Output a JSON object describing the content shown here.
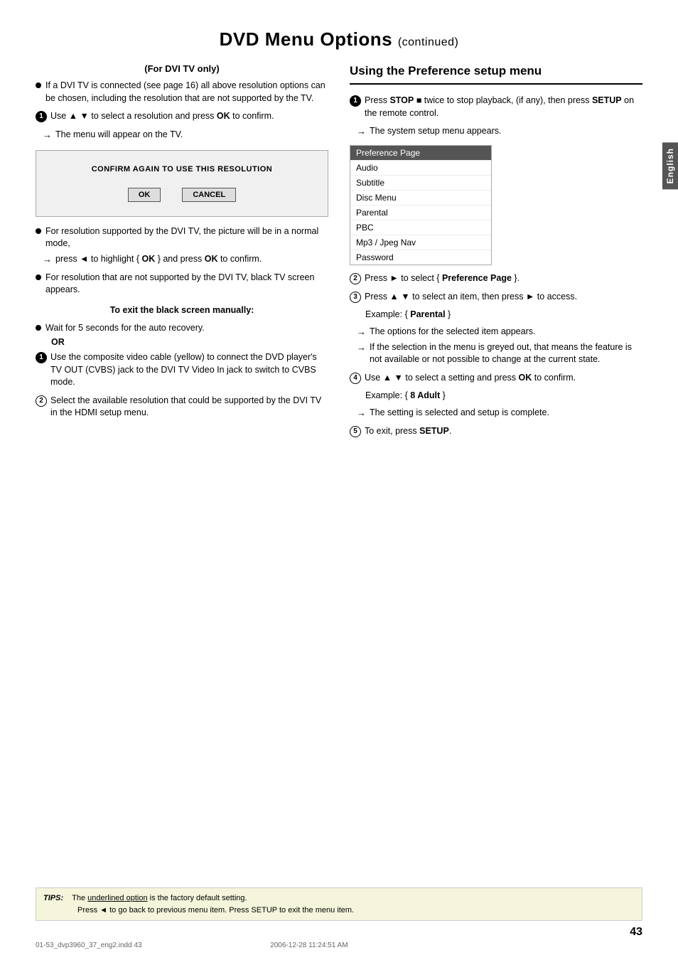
{
  "page": {
    "title": "DVD Menu Options",
    "continued": "(continued)",
    "page_number": "43",
    "footer_file": "01-53_dvp3960_37_eng2.indd   43",
    "footer_date": "2006-12-28   11:24:51 AM"
  },
  "english_label": "English",
  "left_column": {
    "section_title": "(For DVI TV only)",
    "items": [
      {
        "type": "bullet",
        "text": "If a DVI TV is connected (see page 16) all above resolution options can be chosen, including the resolution that are not supported by the TV."
      }
    ],
    "step1": {
      "label": "1",
      "text": "Use ▲ ▼ to select a resolution and press OK to confirm.",
      "arrow": "The menu will appear on the TV."
    },
    "dialog": {
      "title": "CONFIRM AGAIN TO USE THIS RESOLUTION",
      "btn_ok": "OK",
      "btn_cancel": "CANCEL"
    },
    "items2": [
      {
        "type": "bullet",
        "text": "For resolution supported by the DVI TV, the picture will be in a normal mode,",
        "arrow": "press ◄ to highlight { OK } and press OK to confirm."
      },
      {
        "type": "bullet",
        "text": "For resolution that are not supported by the DVI TV, black TV screen appears."
      }
    ],
    "black_screen_title": "To exit the black screen manually:",
    "black_screen_items": [
      {
        "type": "bullet",
        "text": "Wait for 5 seconds for the auto recovery.",
        "or": "OR"
      }
    ],
    "step_a": {
      "label": "1",
      "text": "Use the composite video cable (yellow) to connect the DVD player's TV OUT (CVBS) jack to the DVI TV Video In jack to switch to CVBS mode."
    },
    "step_b": {
      "label": "2",
      "text": "Select the available resolution that could be supported by the DVI TV in the HDMI setup menu."
    }
  },
  "right_column": {
    "section_title": "Using the Preference setup menu",
    "step1": {
      "label": "1",
      "text": "Press STOP ■ twice to stop playback, (if any), then press SETUP on the remote control.",
      "arrow": "The system setup menu appears."
    },
    "pref_menu": {
      "items": [
        {
          "label": "Preference Page",
          "highlighted": true
        },
        {
          "label": "Audio",
          "highlighted": false
        },
        {
          "label": "Subtitle",
          "highlighted": false
        },
        {
          "label": "Disc Menu",
          "highlighted": false
        },
        {
          "label": "Parental",
          "highlighted": false
        },
        {
          "label": "PBC",
          "highlighted": false
        },
        {
          "label": "Mp3 / Jpeg Nav",
          "highlighted": false
        },
        {
          "label": "Password",
          "highlighted": false
        }
      ]
    },
    "step2": {
      "label": "2",
      "text": "Press ► to select { Preference Page }."
    },
    "step3": {
      "label": "3",
      "text": "Press ▲ ▼ to select an item, then press ► to access.",
      "example_label": "Example: { Parental }",
      "arrows": [
        "The options for the selected item appears.",
        "If the selection in the menu is greyed out, that means the feature is not available or not possible to change at the current state."
      ]
    },
    "step4": {
      "label": "4",
      "text": "Use ▲ ▼ to select a setting and press OK to confirm.",
      "example_label": "Example: { 8 Adult }",
      "arrows": [
        "The setting is selected and setup is complete."
      ]
    },
    "step5": {
      "label": "5",
      "text": "To exit, press SETUP."
    }
  },
  "tips": {
    "label": "TIPS:",
    "line1": "The underlined option is the factory default setting.",
    "line2": "Press ◄ to go back to previous menu item. Press SETUP to exit the menu item."
  }
}
